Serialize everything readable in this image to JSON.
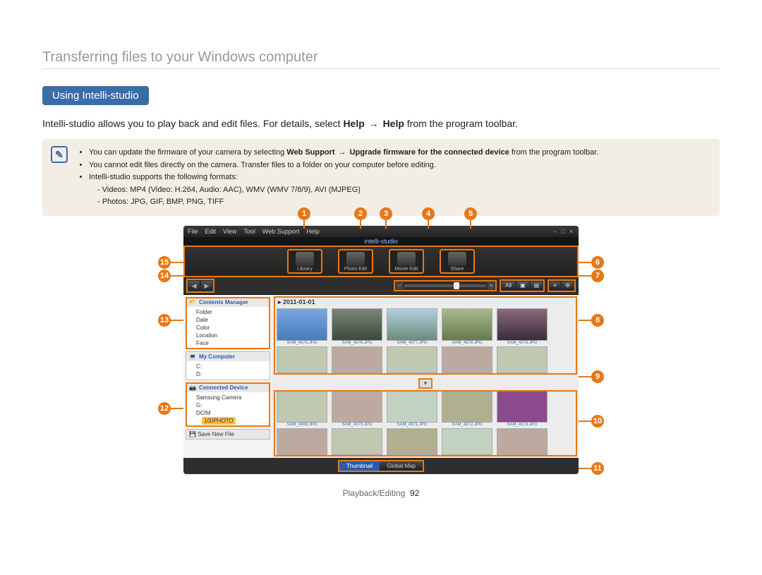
{
  "breadcrumb": "Transferring files to your Windows computer",
  "section_heading": "Using Intelli-studio",
  "intro": {
    "pre": "Intelli-studio allows you to play back and edit files. For details, select ",
    "help1": "Help",
    "arrow": "→",
    "help2": "Help",
    "post": " from the program toolbar."
  },
  "note": {
    "b1_pre": "You can update the firmware of your camera by selecting ",
    "b1_bold1": "Web Support",
    "b1_arrow": "→",
    "b1_bold2": "Upgrade firmware for the connected device",
    "b1_post": " from the program toolbar.",
    "b2": "You cannot edit files directly on the camera. Transfer files to a folder on your computer before editing.",
    "b3": "Intelli-studio supports the following formats:",
    "b3a": "Videos: MP4 (Video: H.264, Audio: AAC), WMV (WMV 7/8/9), AVI (MJPEG)",
    "b3b": "Photos: JPG, GIF, BMP, PNG, TIFF"
  },
  "menubar": {
    "items": [
      "File",
      "Edit",
      "View",
      "Tool",
      "Web Support",
      "Help"
    ],
    "brand": "intelli-studio"
  },
  "modes": {
    "0": {
      "label": "Library"
    },
    "1": {
      "label": "Photo Edit"
    },
    "2": {
      "label": "Movie Edit"
    },
    "3": {
      "label": "Share"
    }
  },
  "toolbox": {
    "all": "All"
  },
  "sidebar": {
    "contents_title": "Contents Manager",
    "contents_items": {
      "0": "Folder",
      "1": "Date",
      "2": "Color",
      "3": "Location",
      "4": "Face"
    },
    "mycomp_title": "My Computer",
    "mycomp_items": {
      "0": "C:",
      "1": "D:"
    },
    "device_title": "Connected Device",
    "device_tree": {
      "0": "Samsung Camera",
      "1": "G:",
      "2": "DCIM",
      "3": "100PHOTO"
    },
    "save_new": "Save New File"
  },
  "content": {
    "date": "2011-01-01",
    "row1": {
      "0": "SAM_4375.JPG",
      "1": "SAM_4376.JPG",
      "2": "SAM_4377.JPG",
      "3": "SAM_4378.JPG",
      "4": "SAM_4379.JPG"
    },
    "row2": {
      "0": "SAM_4369.JPG",
      "1": "SAM_4370.JPG",
      "2": "SAM_4371.JPG",
      "3": "SAM_4372.JPG",
      "4": "SAM_4373.JPG"
    }
  },
  "bottom": {
    "thumbnail": "Thumbnail",
    "map": "Global Map"
  },
  "callouts": {
    "1": "1",
    "2": "2",
    "3": "3",
    "4": "4",
    "5": "5",
    "6": "6",
    "7": "7",
    "8": "8",
    "9": "9",
    "10": "10",
    "11": "11",
    "12": "12",
    "13": "13",
    "14": "14",
    "15": "15"
  },
  "footer": {
    "section": "Playback/Editing",
    "page": "92"
  }
}
